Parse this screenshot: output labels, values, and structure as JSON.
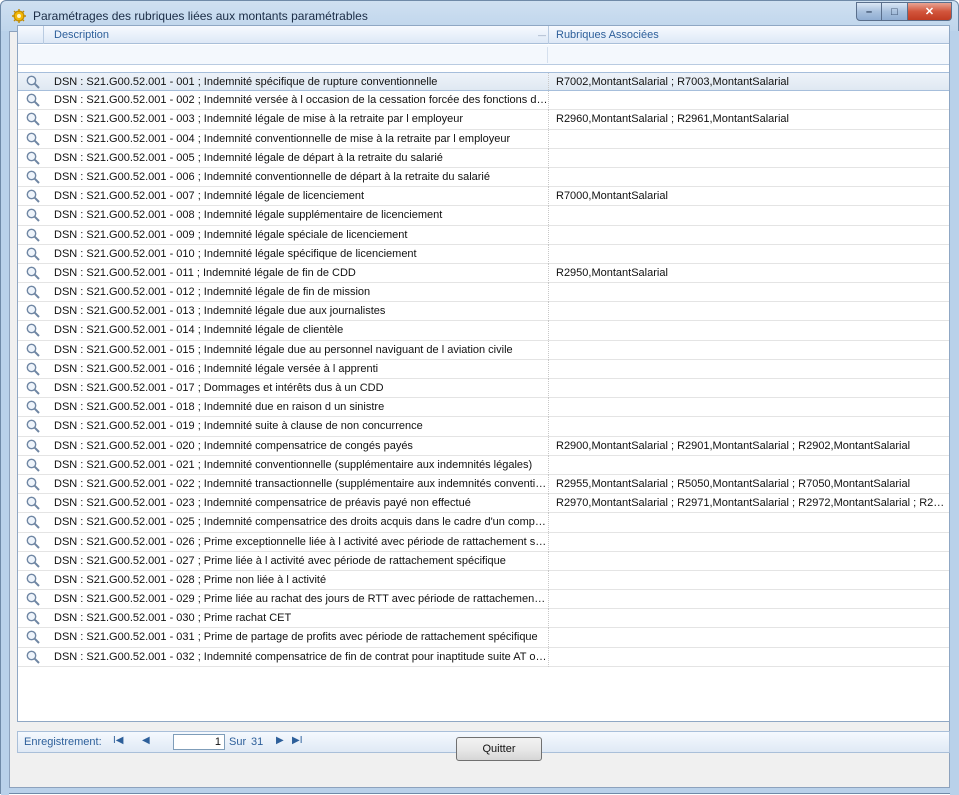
{
  "window": {
    "title": "Paramétrages des rubriques liées aux montants paramétrables",
    "controls": {
      "minimize": "–",
      "maximize": "□",
      "close": "✕"
    }
  },
  "grid": {
    "columns": {
      "description": "Description",
      "rubriques": "Rubriques Associées"
    },
    "rows": [
      {
        "description": "DSN : S21.G00.52.001 - 001 ; Indemnité spécifique de rupture conventionnelle",
        "rubriques": "R7002,MontantSalarial ; R7003,MontantSalarial",
        "selected": true
      },
      {
        "description": "DSN : S21.G00.52.001 - 002 ; Indemnité versée à l occasion de la cessation forcée des fonctions de...",
        "rubriques": ""
      },
      {
        "description": "DSN : S21.G00.52.001 - 003 ; Indemnité légale de mise à la retraite par l employeur",
        "rubriques": "R2960,MontantSalarial ; R2961,MontantSalarial"
      },
      {
        "description": "DSN : S21.G00.52.001 - 004 ; Indemnité conventionnelle de mise à la retraite par l employeur",
        "rubriques": ""
      },
      {
        "description": "DSN : S21.G00.52.001 - 005 ; Indemnité légale de départ à la retraite du salarié",
        "rubriques": ""
      },
      {
        "description": "DSN : S21.G00.52.001 - 006 ; Indemnité conventionnelle de départ à la retraite du salarié",
        "rubriques": ""
      },
      {
        "description": "DSN : S21.G00.52.001 - 007 ; Indemnité légale de licenciement",
        "rubriques": "R7000,MontantSalarial"
      },
      {
        "description": "DSN : S21.G00.52.001 - 008 ; Indemnité légale supplémentaire de licenciement",
        "rubriques": ""
      },
      {
        "description": "DSN : S21.G00.52.001 - 009 ; Indemnité légale spéciale de licenciement",
        "rubriques": ""
      },
      {
        "description": "DSN : S21.G00.52.001 - 010 ; Indemnité légale spécifique de licenciement",
        "rubriques": ""
      },
      {
        "description": "DSN : S21.G00.52.001 - 011 ; Indemnité légale de fin de CDD",
        "rubriques": "R2950,MontantSalarial"
      },
      {
        "description": "DSN : S21.G00.52.001 - 012 ; Indemnité légale de fin de mission",
        "rubriques": ""
      },
      {
        "description": "DSN : S21.G00.52.001 - 013 ; Indemnité légale due aux journalistes",
        "rubriques": ""
      },
      {
        "description": "DSN : S21.G00.52.001 - 014 ; Indemnité légale de clientèle",
        "rubriques": ""
      },
      {
        "description": "DSN : S21.G00.52.001 - 015 ; Indemnité légale due au personnel naviguant de l aviation civile",
        "rubriques": ""
      },
      {
        "description": "DSN : S21.G00.52.001 - 016 ; Indemnité légale versée à l apprenti",
        "rubriques": ""
      },
      {
        "description": "DSN : S21.G00.52.001 - 017 ; Dommages et intérêts dus à un CDD",
        "rubriques": ""
      },
      {
        "description": "DSN : S21.G00.52.001 - 018 ; Indemnité due en raison d un sinistre",
        "rubriques": ""
      },
      {
        "description": "DSN : S21.G00.52.001 - 019 ; Indemnité suite à clause de non concurrence",
        "rubriques": ""
      },
      {
        "description": "DSN : S21.G00.52.001 - 020 ; Indemnité compensatrice de congés payés",
        "rubriques": "R2900,MontantSalarial ; R2901,MontantSalarial ; R2902,MontantSalarial"
      },
      {
        "description": "DSN : S21.G00.52.001 - 021 ; Indemnité conventionnelle (supplémentaire aux indemnités légales)",
        "rubriques": ""
      },
      {
        "description": "DSN : S21.G00.52.001 - 022 ; Indemnité transactionnelle (supplémentaire aux indemnités convention...",
        "rubriques": "R2955,MontantSalarial ; R5050,MontantSalarial ; R7050,MontantSalarial"
      },
      {
        "description": "DSN : S21.G00.52.001 - 023 ; Indemnité compensatrice de préavis payé non effectué",
        "rubriques": "R2970,MontantSalarial ; R2971,MontantSalarial ; R2972,MontantSalarial ; R297..."
      },
      {
        "description": "DSN : S21.G00.52.001 - 025 ; Indemnité compensatrice des droits acquis dans le cadre d'un compte...",
        "rubriques": ""
      },
      {
        "description": "DSN : S21.G00.52.001 - 026 ; Prime exceptionnelle liée à l activité avec période de rattachement sp...",
        "rubriques": ""
      },
      {
        "description": "DSN : S21.G00.52.001 - 027 ; Prime liée à l activité avec période de rattachement spécifique",
        "rubriques": ""
      },
      {
        "description": "DSN : S21.G00.52.001 - 028 ; Prime non liée à l activité",
        "rubriques": ""
      },
      {
        "description": "DSN : S21.G00.52.001 - 029 ; Prime liée au rachat des jours de RTT avec période de rattachement ...",
        "rubriques": ""
      },
      {
        "description": "DSN : S21.G00.52.001 - 030 ; Prime rachat CET",
        "rubriques": ""
      },
      {
        "description": "DSN : S21.G00.52.001 - 031 ; Prime de partage de profits avec période de rattachement spécifique",
        "rubriques": ""
      },
      {
        "description": "DSN : S21.G00.52.001 - 032 ; Indemnité compensatrice de fin de contrat pour inaptitude suite AT ou...",
        "rubriques": ""
      }
    ]
  },
  "navigator": {
    "label": "Enregistrement:",
    "first": "I◀",
    "prev": "◀",
    "current": "1",
    "sur": "Sur",
    "total": "31",
    "next": "▶",
    "last": "▶I"
  },
  "buttons": {
    "quit": "Quitter"
  },
  "colors": {
    "accent": "#2d5f9a",
    "close": "#c13b22",
    "selection": "#dfe8f2"
  },
  "icons": {
    "row": "magnifier-icon",
    "app": "gear-star-icon"
  }
}
